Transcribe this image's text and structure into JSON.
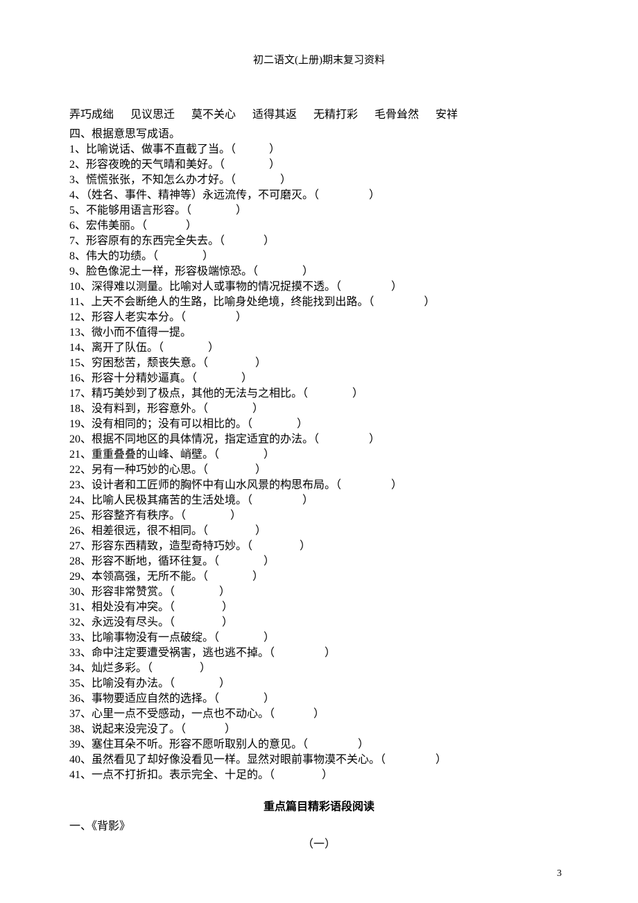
{
  "header": {
    "title": "初二语文(上册)期末复习资料"
  },
  "idioms_row": "弄巧成绌      见议思迁      莫不关心      适得其返      无精打彩      毛骨耸然      安祥",
  "section4_title": "四、根据意思写成语。",
  "items": [
    "1、比喻说话、做事不直截了当。（            ）",
    "2、形容夜晚的天气晴和美好。（                ）",
    "3、慌慌张张，不知怎么办才好。（                ）",
    "4、（姓名、事件、精神等）永远流传，不可磨灭。（                  ）",
    "5、不能够用语言形容。（                ）",
    "6、宏伟美丽。（              ）",
    "7、形容原有的东西完全失去。（              ）",
    "8、伟大的功绩。（                ）",
    "9、脸色像泥土一样，形容极端惊恐。（                ）",
    "10、深得难以测量。比喻对人或事物的情况捉摸不透。（                  ）",
    "11、上天不会断绝人的生路，比喻身处绝境，终能找到出路。（                  ）",
    "12、形容人老实本分。（                  ）",
    "13、微小而不值得一提。",
    "14、离开了队伍。（                ）",
    "15、穷困愁苦，颓丧失意。（                 ）",
    "16、形容十分精妙逼真。（                ）",
    "17、精巧美妙到了极点，其他的无法与之相比。（                ）",
    "18、没有料到，形容意外。（                ）",
    "19、没有相同的；没有可以相比的。（                ）",
    "20、根据不同地区的具体情况，指定适宜的办法。（                  ）",
    "21、重重叠叠的山峰、峭壁。（                ）",
    "22、另有一种巧妙的心思。（                 ）",
    "23、设计者和工匠师的胸怀中有山水风景的构思布局。（                  ）",
    "24、比喻人民极其痛苦的生活处境。（                  ）",
    "25、形容整齐有秩序。（                ）",
    "26、相差很远，很不相同。（                 ）",
    "27、形容东西精致，造型奇特巧妙。（                 ）",
    "28、形容不断地，循环往复。（                ）",
    "29、本领高强，无所不能。（                ）",
    "30、形容非常赞赏。（                ）",
    "31、相处没有冲突。（                 ）",
    "32、永远没有尽头。（                 ）",
    "33、比喻事物没有一点破绽。（                ）",
    "33、命中注定要遭受祸害，逃也逃不掉。（                  ）",
    "34、灿烂多彩。（                 ）",
    "35、比喻没有办法。（                ）",
    "36、事物要适应自然的选择。（                ）",
    "37、心里一点不受感动，一点也不动心。（              ）",
    "38、说起来没完没了。（              ）",
    "39、塞住耳朵不听。形容不愿听取别人的意见。（                  ）",
    "40、虽然看见了却好像没看见一样。显然对眼前事物漠不关心。（                  ）",
    "41、一点不打折扣。表示完全、十足的。（                 ）"
  ],
  "reading_section": {
    "title": "重点篇目精彩语段阅读"
  },
  "essay": {
    "heading": "一、《背影》",
    "part_label": "（一）"
  },
  "page_number": "3"
}
